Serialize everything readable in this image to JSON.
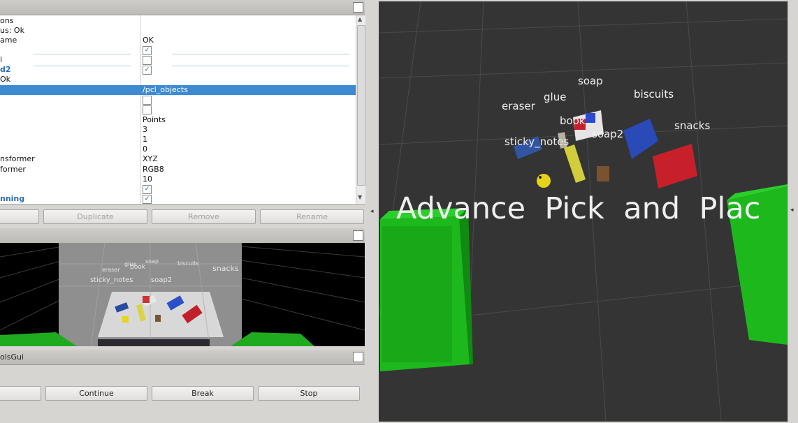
{
  "displays_panel": {
    "rows": [
      {
        "key": "ons"
      },
      {
        "key": "us: Ok"
      },
      {
        "key": "ame",
        "value": "OK"
      },
      {
        "key": "",
        "checkbox": true
      },
      {
        "key": "l",
        "checkbox": false
      },
      {
        "key": "d2",
        "checkbox": true
      },
      {
        "key": "Ok"
      },
      {
        "key": "",
        "value": "/pcl_objects",
        "selected": true
      },
      {
        "key": "",
        "checkbox": false
      },
      {
        "key": "",
        "checkbox": false
      },
      {
        "key": "",
        "value": "Points"
      },
      {
        "key": "",
        "value": "3"
      },
      {
        "key": "",
        "value": "1"
      },
      {
        "key": "",
        "value": "0"
      },
      {
        "key": "nsformer",
        "value": "XYZ"
      },
      {
        "key": "former",
        "value": "RGB8"
      },
      {
        "key": "",
        "value": "10"
      },
      {
        "key": "",
        "checkbox": true
      },
      {
        "key": "nning",
        "checkbox": true
      }
    ],
    "buttons": {
      "duplicate": "Duplicate",
      "remove": "Remove",
      "rename": "Rename"
    }
  },
  "camera_panel": {
    "labels": {
      "glue": "glue",
      "eraser": "eraser",
      "book": "book",
      "soap": "soap",
      "biscuits": "biscuits",
      "snacks": "snacks",
      "sticky_notes": "sticky_notes",
      "soap2": "soap2"
    }
  },
  "tools_panel": {
    "title": "olsGui",
    "buttons": {
      "continue": "Continue",
      "break": "Break",
      "stop": "Stop"
    }
  },
  "main_view": {
    "banner": "Advance  Pick  and  Plac",
    "labels": {
      "soap": "soap",
      "glue": "glue",
      "eraser": "eraser",
      "biscuits": "biscuits",
      "book": "book",
      "snacks": "snacks",
      "sticky_notes": "sticky_notes",
      "soap2": "soap2"
    }
  }
}
